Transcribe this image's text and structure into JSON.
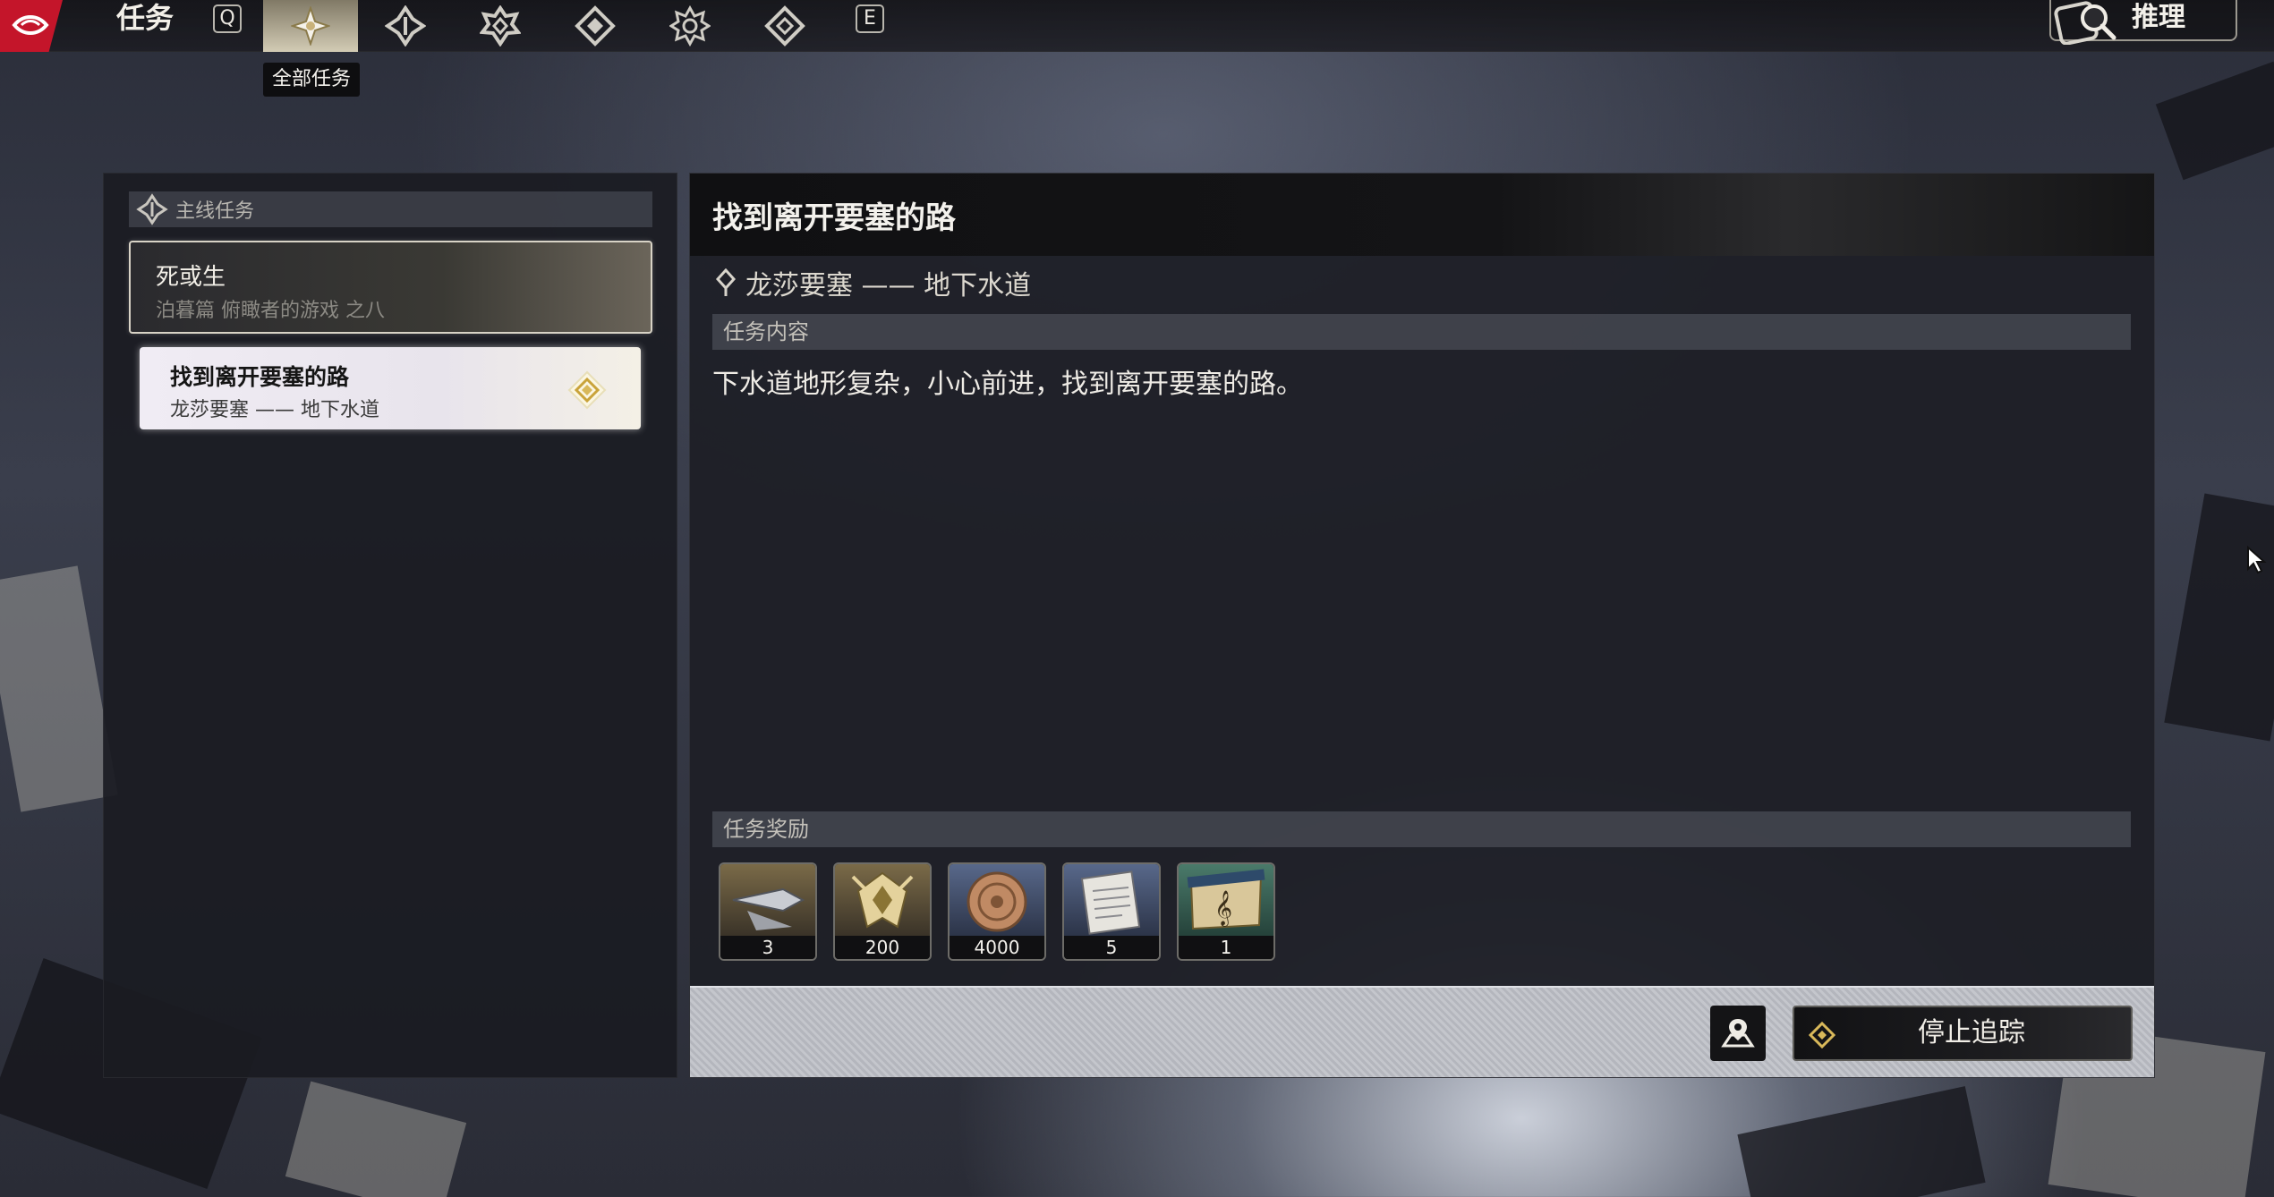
{
  "topbar": {
    "title": "任务",
    "key_left": "Q",
    "key_right": "E",
    "tabs": [
      {
        "icon": "all-quests-icon",
        "active": true
      },
      {
        "icon": "main-quest-icon",
        "active": false
      },
      {
        "icon": "companion-quest-icon",
        "active": false
      },
      {
        "icon": "side-quest-icon",
        "active": false
      },
      {
        "icon": "event-quest-icon",
        "active": false
      },
      {
        "icon": "daily-quest-icon",
        "active": false
      }
    ],
    "active_tab_tooltip": "全部任务",
    "deduce_label": "推理"
  },
  "left_panel": {
    "section_label": "主线任务",
    "group": {
      "title": "死或生",
      "subtitle": "泊暮篇 俯瞰者的游戏 之八"
    },
    "selected_quest": {
      "title": "找到离开要塞的路",
      "location": "龙莎要塞 —— 地下水道"
    }
  },
  "detail": {
    "title": "找到离开要塞的路",
    "location": "龙莎要塞 —— 地下水道",
    "content_label": "任务内容",
    "description": "下水道地形复杂，小心前进，找到离开要塞的路。",
    "rewards_label": "任务奖励",
    "rewards": [
      {
        "icon": "weapon-material-icon",
        "qty": "3"
      },
      {
        "icon": "emblem-currency-icon",
        "qty": "200"
      },
      {
        "icon": "coin-icon",
        "qty": "4000"
      },
      {
        "icon": "document-scroll-icon",
        "qty": "5"
      },
      {
        "icon": "music-sheet-icon",
        "qty": "1"
      }
    ],
    "stop_tracking_label": "停止追踪"
  },
  "colors": {
    "accent_red": "#c4152a",
    "gold": "#d8b85a"
  }
}
